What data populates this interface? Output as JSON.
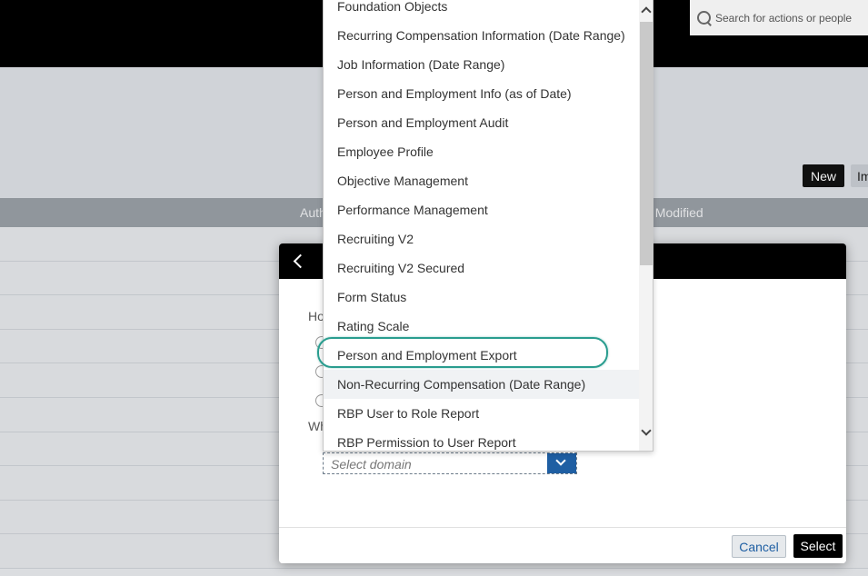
{
  "header": {
    "search_placeholder": "Search for actions or people"
  },
  "toolbar": {
    "new_label": "New",
    "import_label": "Im"
  },
  "table": {
    "headers": [
      "Auth",
      "st Modified"
    ]
  },
  "dialog": {
    "question1_label": "Ho",
    "question2_label": "Wh",
    "domain_select": {
      "placeholder": "Select domain"
    },
    "cancel_label": "Cancel",
    "select_label": "Select"
  },
  "dropdown": {
    "options": [
      "Foundation Objects",
      "Recurring Compensation Information (Date Range)",
      "Job Information (Date Range)",
      "Person and Employment Info (as of Date)",
      "Person and Employment Audit",
      "Employee Profile",
      "Objective Management",
      "Performance Management",
      "Recruiting V2",
      "Recruiting V2 Secured",
      "Form Status",
      "Rating Scale",
      "Person and Employment Export",
      "Non-Recurring Compensation (Date Range)",
      "RBP User to Role Report",
      "RBP Permission to User Report"
    ],
    "highlighted_option": "Person and Employment Export",
    "hovered_option": "Non-Recurring Compensation (Date Range)"
  },
  "colors": {
    "accent": "#1f5fa3",
    "highlight_ring": "#2a9d8f"
  }
}
